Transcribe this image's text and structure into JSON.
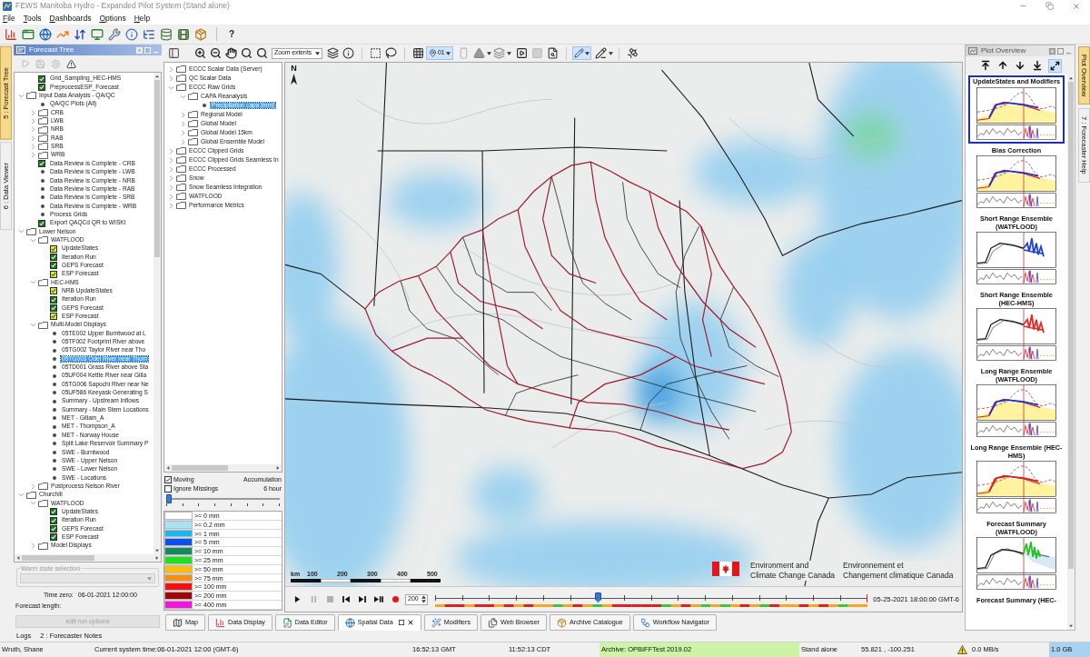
{
  "window": {
    "title": "FEWS Manitoba Hydro - Expanded Pilot System (Stand alone)"
  },
  "menu": [
    "File",
    "Tools",
    "Dashboards",
    "Options",
    "Help"
  ],
  "toolbar": {
    "help_label": "?"
  },
  "left_tabs": [
    {
      "label": "5 : Forecast Tree",
      "selected": true
    },
    {
      "label": "6 : Data Viewer",
      "selected": false
    }
  ],
  "forecast_tree": {
    "title": "Forecast Tree",
    "items": [
      {
        "children": [
          {
            "kind": "check",
            "label": "Grid_Sampling_HEC-HMS",
            "checked": true,
            "color": "#1f7a1f",
            "selected": false
          },
          {
            "kind": "check",
            "label": "PreprocessESP_Forecast",
            "checked": true,
            "color": "#1f7a1f",
            "selected": false
          }
        ]
      },
      {
        "kind": "folder",
        "label": "Input Data Analysis - QA/QC",
        "expanded": true,
        "selected": false,
        "children": [
          {
            "kind": "leaf",
            "label": "QA/QC Plots (All)",
            "selected": false
          },
          {
            "kind": "folder",
            "label": "CRB",
            "expanded": false,
            "selected": false
          },
          {
            "kind": "folder",
            "label": "LWB",
            "expanded": false,
            "selected": false
          },
          {
            "kind": "folder",
            "label": "NRB",
            "expanded": false,
            "selected": false
          },
          {
            "kind": "folder",
            "label": "RAB",
            "expanded": false,
            "selected": false
          },
          {
            "kind": "folder",
            "label": "SRB",
            "expanded": false,
            "selected": false
          },
          {
            "kind": "folder",
            "label": "WRB",
            "expanded": false,
            "selected": false
          },
          {
            "kind": "check",
            "label": "Data Review is Complete - CRB",
            "checked": true,
            "color": "#1f7a1f",
            "selected": false
          },
          {
            "kind": "leaf",
            "label": "Data Review is Complete - LWB",
            "selected": false
          },
          {
            "kind": "leaf",
            "label": "Data Review is Complete - NRB",
            "selected": false
          },
          {
            "kind": "leaf",
            "label": "Data Review is Complete - RAB",
            "selected": false
          },
          {
            "kind": "leaf",
            "label": "Data Review is Complete - SRB",
            "selected": false
          },
          {
            "kind": "leaf",
            "label": "Data Review is Complete - WRB",
            "selected": false
          },
          {
            "kind": "leaf",
            "label": "Process Grids",
            "selected": false
          },
          {
            "kind": "check",
            "label": "Export QAQCd QR to WISKI",
            "checked": true,
            "color": "#1f7a1f",
            "selected": false
          }
        ]
      },
      {
        "kind": "folder",
        "label": "Lower Nelson",
        "expanded": true,
        "selected": false,
        "children": [
          {
            "kind": "folder",
            "label": "WATFLOOD",
            "expanded": true,
            "selected": false,
            "children": [
              {
                "kind": "check",
                "label": "UpdateStates",
                "checked": true,
                "color": "#e4e43a",
                "selected": false
              },
              {
                "kind": "check",
                "label": "Iteration Run",
                "checked": true,
                "color": "#1f7a1f",
                "selected": false
              },
              {
                "kind": "check",
                "label": "GEPS Forecast",
                "checked": true,
                "color": "#1f7a1f",
                "selected": false
              },
              {
                "kind": "check",
                "label": "ESP Forecast",
                "checked": true,
                "color": "#e4e43a",
                "selected": false
              }
            ]
          },
          {
            "kind": "folder",
            "label": "HEC-HMS",
            "expanded": true,
            "selected": false,
            "children": [
              {
                "kind": "check",
                "label": "NRB UpdateStates",
                "checked": true,
                "color": "#e4e43a",
                "selected": false
              },
              {
                "kind": "check",
                "label": "Iteration Run",
                "checked": true,
                "color": "#1f7a1f",
                "selected": false
              },
              {
                "kind": "check",
                "label": "GEPS Forecast",
                "checked": true,
                "color": "#1f7a1f",
                "selected": false
              },
              {
                "kind": "check",
                "label": "ESP Forecast",
                "checked": true,
                "color": "#e4e43a",
                "selected": false
              }
            ]
          },
          {
            "kind": "folder",
            "label": "Multi-Model Displays",
            "expanded": true,
            "selected": false,
            "children": [
              {
                "kind": "leaf",
                "label": "05TE002 Upper Burntwood at L",
                "selected": false
              },
              {
                "kind": "leaf",
                "label": "05TF002 Footprint River above",
                "selected": false
              },
              {
                "kind": "leaf",
                "label": "05TG002 Taylor River near Tho",
                "selected": false
              },
              {
                "kind": "leaf",
                "label": "05TG003 Odei River near Thom",
                "selected": true
              },
              {
                "kind": "leaf",
                "label": "05TD001 Grass River above Sta",
                "selected": false
              },
              {
                "kind": "leaf",
                "label": "05UF004 Kettle River near Gilla",
                "selected": false
              },
              {
                "kind": "leaf",
                "label": "05TG006 Sapochi River near Ne",
                "selected": false
              },
              {
                "kind": "leaf",
                "label": "05UF586 Keeyask Generating S",
                "selected": false
              },
              {
                "kind": "leaf",
                "label": "Summary - Upstream Inflows",
                "selected": false
              },
              {
                "kind": "leaf",
                "label": "Summary - Main Stem Locations",
                "selected": false
              },
              {
                "kind": "leaf",
                "label": "MET - Gillam_A",
                "selected": false
              },
              {
                "kind": "leaf",
                "label": "MET - Thompson_A",
                "selected": false
              },
              {
                "kind": "leaf",
                "label": "MET - Norway House",
                "selected": false
              },
              {
                "kind": "leaf",
                "label": "Split Lake Reservoir Summary P",
                "selected": false
              },
              {
                "kind": "leaf",
                "label": "SWE - Burntwood",
                "selected": false
              },
              {
                "kind": "leaf",
                "label": "SWE - Upper Nelson",
                "selected": false
              },
              {
                "kind": "leaf",
                "label": "SWE - Lower Nelson",
                "selected": false
              },
              {
                "kind": "leaf",
                "label": "SWE - Locations",
                "selected": false
              }
            ]
          },
          {
            "kind": "folder",
            "label": "Postprocess Nelson River",
            "expanded": false,
            "selected": false
          }
        ]
      },
      {
        "kind": "folder",
        "label": "Churchill",
        "expanded": true,
        "selected": false,
        "children": [
          {
            "kind": "folder",
            "label": "WATFLOOD",
            "expanded": true,
            "selected": false,
            "children": [
              {
                "kind": "check",
                "label": "UpdateStates",
                "checked": true,
                "color": "#1f7a1f",
                "selected": false
              },
              {
                "kind": "check",
                "label": "Iteration Run",
                "checked": true,
                "color": "#1f7a1f",
                "selected": false
              },
              {
                "kind": "check",
                "label": "GEPS Forecast",
                "checked": true,
                "color": "#1f7a1f",
                "selected": false
              },
              {
                "kind": "check",
                "label": "ESP Forecast",
                "checked": true,
                "color": "#1f7a1f",
                "selected": false
              }
            ]
          },
          {
            "kind": "folder",
            "label": "Model Displays",
            "expanded": false,
            "selected": false
          }
        ]
      }
    ]
  },
  "run_options": {
    "warm_state_label": "Warm state selection",
    "time_zero_label": "Time zero:",
    "time_zero": "06-01-2021 12:00:00",
    "forecast_length_label": "Forecast length:",
    "edit_button": "edit run options"
  },
  "map_toolbar": {
    "zoom_dropdown": "Zoom extents",
    "location_label": "01"
  },
  "data_tree": {
    "items": [
      {
        "kind": "folder",
        "label": "ECCC Scalar Data (Server)",
        "expanded": false,
        "selected": false
      },
      {
        "kind": "folder",
        "label": "QC Scalar Data",
        "expanded": false,
        "selected": false
      },
      {
        "kind": "folder",
        "label": "ECCC Raw Grids",
        "expanded": true,
        "selected": false,
        "children": [
          {
            "kind": "folder",
            "label": "CAPA Reanalysis",
            "expanded": true,
            "selected": false,
            "children": [
              {
                "kind": "leaf",
                "label": "Precipitation capa [mm]",
                "selected": true
              }
            ]
          },
          {
            "kind": "folder",
            "label": "Regional Model",
            "expanded": false,
            "selected": false
          },
          {
            "kind": "folder",
            "label": "Global Model",
            "expanded": false,
            "selected": false
          },
          {
            "kind": "folder",
            "label": "Global Model 15km",
            "expanded": false,
            "selected": false
          },
          {
            "kind": "folder",
            "label": "Global Ensemble Model",
            "expanded": false,
            "selected": false
          }
        ]
      },
      {
        "kind": "folder",
        "label": "ECCC Clipped Grids",
        "expanded": false,
        "selected": false
      },
      {
        "kind": "folder",
        "label": "ECCC Clipped Grids Seamless In",
        "expanded": false,
        "selected": false
      },
      {
        "kind": "folder",
        "label": "ECCC Processed",
        "expanded": false,
        "selected": false
      },
      {
        "kind": "folder",
        "label": "Snow",
        "expanded": false,
        "selected": false
      },
      {
        "kind": "folder",
        "label": "Snow Seamless Integration",
        "expanded": false,
        "selected": false
      },
      {
        "kind": "folder",
        "label": "WATFLOOD",
        "expanded": false,
        "selected": false
      },
      {
        "kind": "folder",
        "label": "Performance Metrics",
        "expanded": false,
        "selected": false
      }
    ]
  },
  "display_options": [
    {
      "label": "Moving",
      "checked": true
    },
    {
      "label": "Ignore Missings",
      "checked": false
    }
  ],
  "accumulation": {
    "label": "Accumulation",
    "value": "6 hour",
    "level": 0
  },
  "legend": [
    {
      "label": ">= 0 mm",
      "color": "#ffffff"
    },
    {
      "label": ">= 0.2 mm",
      "color": "#a6e3f7"
    },
    {
      "label": ">= 1 mm",
      "color": "#19b7f2"
    },
    {
      "label": ">= 5 mm",
      "color": "#0a4ff0"
    },
    {
      "label": ">= 10 mm",
      "color": "#138a5e"
    },
    {
      "label": ">= 25 mm",
      "color": "#1fe01f"
    },
    {
      "label": ">= 50 mm",
      "color": "#fcbf08"
    },
    {
      "label": ">= 75 mm",
      "color": "#fd8c0a"
    },
    {
      "label": ">= 100 mm",
      "color": "#f81010"
    },
    {
      "label": ">= 200 mm",
      "color": "#9a0606"
    },
    {
      "label": ">= 400 mm",
      "color": "#f414e0"
    }
  ],
  "map": {
    "north_label": "N",
    "scale_labels": [
      "km",
      "100",
      "200",
      "300",
      "400",
      "500"
    ],
    "agency_en": [
      "Environment and",
      "Climate Change Canada"
    ],
    "agency_fr": [
      "Environnement et",
      "Changement climatique Canada"
    ]
  },
  "timeline": {
    "speed": "200",
    "level": 0.375,
    "time": "05-25-2021 18:00:00 GMT-6"
  },
  "display_tabs": [
    {
      "label": "Map",
      "selected": false
    },
    {
      "label": "Data Display",
      "selected": false
    },
    {
      "label": "Data Editor",
      "selected": false
    },
    {
      "label": "Spatial Data",
      "selected": true
    },
    {
      "label": "Modifiers",
      "selected": false
    },
    {
      "label": "Web Browser",
      "selected": false
    },
    {
      "label": "Archive Catalogue",
      "selected": false
    },
    {
      "label": "Workflow Navigator",
      "selected": false
    }
  ],
  "plot_overview": {
    "title": "Plot Overview",
    "plots": [
      {
        "title": "UpdateStates and Modifiers",
        "selected": true,
        "kind": "band",
        "color": "#2233cc"
      },
      {
        "title": "Bias Correction",
        "selected": false,
        "kind": "band",
        "color": "#2233cc"
      },
      {
        "title": "Short Range Ensemble (WATFLOOD)",
        "selected": false,
        "kind": "ensemble",
        "color": "#1f3fd8"
      },
      {
        "title": "Short Range Ensemble (HEC-HMS)",
        "selected": false,
        "kind": "ensemble",
        "color": "#e02a2a"
      },
      {
        "title": "Long Range Ensemble (WATFLOOD)",
        "selected": false,
        "kind": "band",
        "color": "#2233cc"
      },
      {
        "title": "Long Range Ensemble (HEC-HMS)",
        "selected": false,
        "kind": "band",
        "color": "#d82020"
      },
      {
        "title": "Forecast Summary (WATFLOOD)",
        "selected": false,
        "kind": "summary",
        "color": "#22c022"
      },
      {
        "title": "Forecast Summary (HEC-",
        "selected": false
      }
    ]
  },
  "right_tabs": [
    {
      "label": "Plot Overview",
      "selected": true
    },
    {
      "label": "7 : Forecaster Help",
      "selected": false
    }
  ],
  "bottom_tool_tabs": [
    "Logs",
    "2 : Forecaster Notes"
  ],
  "status_bar": {
    "user": "Wruth, Shane",
    "system_time": "Current system time:06-01-2021 12:00 (GMT-6)",
    "gmt": "16:52:13 GMT",
    "local": "11:52:13 CDT",
    "archive": "Archive: OPBIFFTest 2019.02",
    "mode": "Stand alone",
    "coordinates": "55.821 , -100.251",
    "transfer_rate": "0.0 MB/s",
    "memory": "1.0 GB"
  }
}
